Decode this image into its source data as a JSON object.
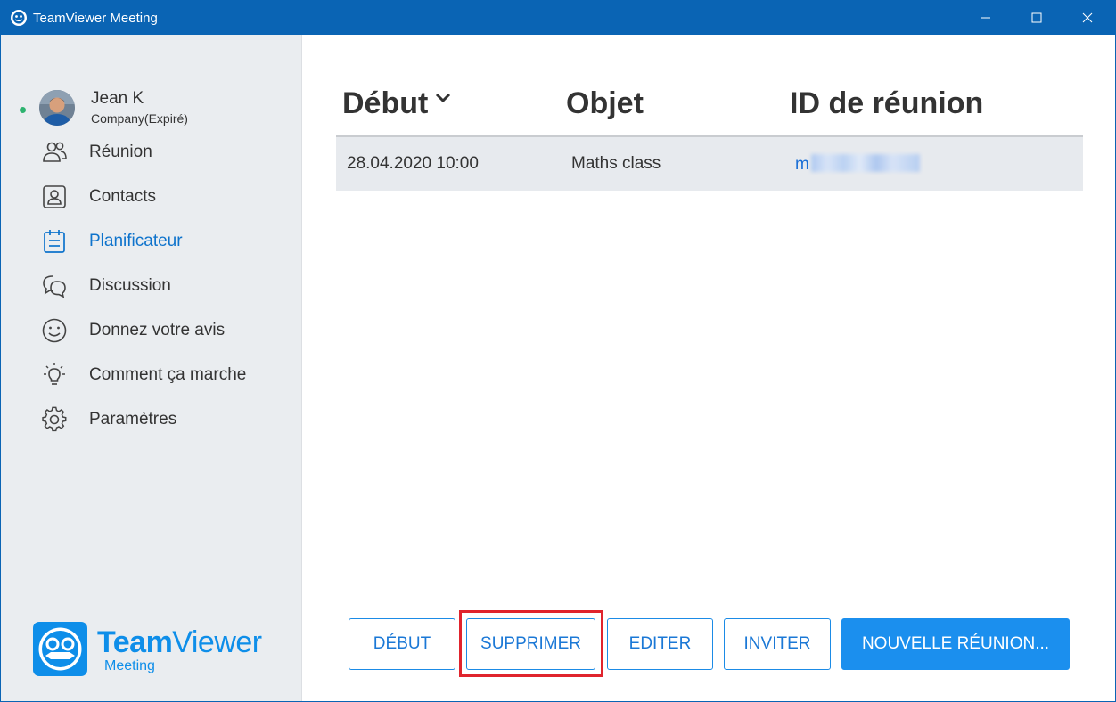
{
  "window": {
    "title": "TeamViewer Meeting"
  },
  "user": {
    "name": "Jean K",
    "company": "Company(Expiré)"
  },
  "sidebar": {
    "items": [
      {
        "label": "Réunion",
        "icon": "people-icon"
      },
      {
        "label": "Contacts",
        "icon": "contact-card-icon"
      },
      {
        "label": "Planificateur",
        "icon": "calendar-icon",
        "active": true
      },
      {
        "label": "Discussion",
        "icon": "chat-bubbles-icon"
      },
      {
        "label": "Donnez votre avis",
        "icon": "smiley-icon"
      },
      {
        "label": "Comment ça marche",
        "icon": "lightbulb-icon"
      },
      {
        "label": "Paramètres",
        "icon": "gear-icon"
      }
    ]
  },
  "logo": {
    "brand_bold": "Team",
    "brand_thin": "Viewer",
    "sub": "Meeting"
  },
  "table": {
    "headers": {
      "start": "Début",
      "subject": "Objet",
      "meeting_id": "ID de réunion"
    },
    "rows": [
      {
        "start": "28.04.2020 10:00",
        "subject": "Maths class",
        "meeting_id_prefix": "m"
      }
    ]
  },
  "buttons": {
    "start": "DÉBUT",
    "delete": "SUPPRIMER",
    "edit": "EDITER",
    "invite": "INVITER",
    "new_meeting": "NOUVELLE RÉUNION..."
  },
  "colors": {
    "titlebar": "#0a64b4",
    "accent": "#1b8fee",
    "active_nav": "#0e73cc",
    "highlight": "#e0242d",
    "online": "#2db36f"
  }
}
